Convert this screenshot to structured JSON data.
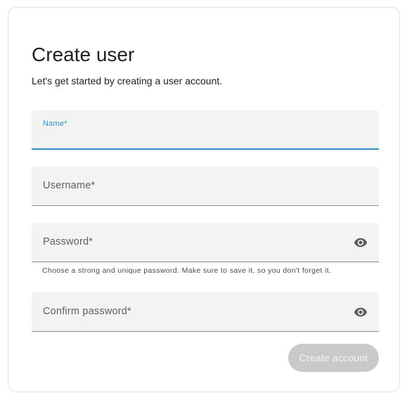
{
  "header": {
    "title": "Create user",
    "subtitle": "Let's get started by creating a user account."
  },
  "fields": {
    "name": {
      "label": "Name*",
      "value": ""
    },
    "username": {
      "label": "Username*",
      "value": ""
    },
    "password": {
      "label": "Password*",
      "value": "",
      "helper": "Choose a strong and unique password. Make sure to save it, so you don't forget it.",
      "toggle_icon": "eye-icon"
    },
    "confirm_password": {
      "label": "Confirm password*",
      "value": "",
      "toggle_icon": "eye-icon"
    }
  },
  "actions": {
    "submit_label": "Create account",
    "submit_enabled": false
  },
  "colors": {
    "accent": "#2f8ec7",
    "field_bg": "#f3f3f3",
    "disabled_button": "#c9c9c9"
  }
}
